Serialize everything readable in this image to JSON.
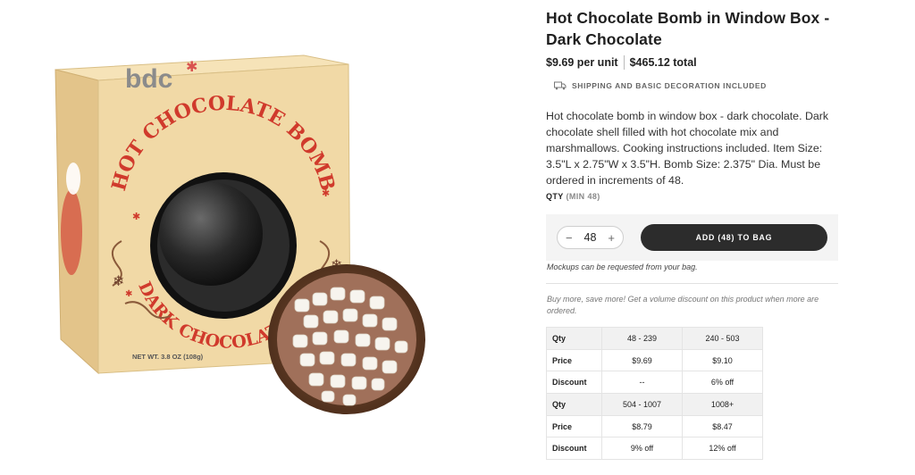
{
  "product": {
    "title": "Hot Chocolate Bomb in Window Box - Dark Chocolate",
    "unit_price": "$9.69 per unit",
    "total_price": "$465.12 total",
    "shipping_note": "SHIPPING AND BASIC DECORATION INCLUDED",
    "description": "Hot chocolate bomb in window box - dark chocolate. Dark chocolate shell filled with hot chocolate mix and marshmallows. Cooking instructions included. Item Size: 3.5\"L x 2.75\"W x 3.5\"H. Bomb Size: 2.375\" Dia. Must be ordered in increments of 48."
  },
  "image": {
    "brand_text": "bdc",
    "arc_text_top": "HOT CHOCOLATE BOMB",
    "arc_text_bottom": "DARK CHOCOLATE",
    "net_weight": "NET WT. 3.8 OZ (108g)"
  },
  "qty": {
    "label": "QTY",
    "min_note": "(MIN 48)",
    "value": "48",
    "minus": "−",
    "plus": "+"
  },
  "cart": {
    "add_label": "ADD (48) TO BAG",
    "mockups_note": "Mockups can be requested from your bag.",
    "volume_note": "Buy more, save more! Get a volume discount on this product when more are ordered."
  },
  "pricing": {
    "rows": [
      {
        "label": "Qty",
        "a": "48 - 239",
        "b": "240 - 503",
        "shade": true
      },
      {
        "label": "Price",
        "a": "$9.69",
        "b": "$9.10",
        "shade": false
      },
      {
        "label": "Discount",
        "a": "--",
        "b": "6% off",
        "shade": false
      },
      {
        "label": "Qty",
        "a": "504 - 1007",
        "b": "1008+",
        "shade": true
      },
      {
        "label": "Price",
        "a": "$8.79",
        "b": "$8.47",
        "shade": false
      },
      {
        "label": "Discount",
        "a": "9% off",
        "b": "12% off",
        "shade": false
      }
    ]
  },
  "colors": {
    "box": "#f1d9a6",
    "box_side": "#e6c98f",
    "accent_red": "#d03a2c",
    "button_dark": "#2c2c2c"
  }
}
